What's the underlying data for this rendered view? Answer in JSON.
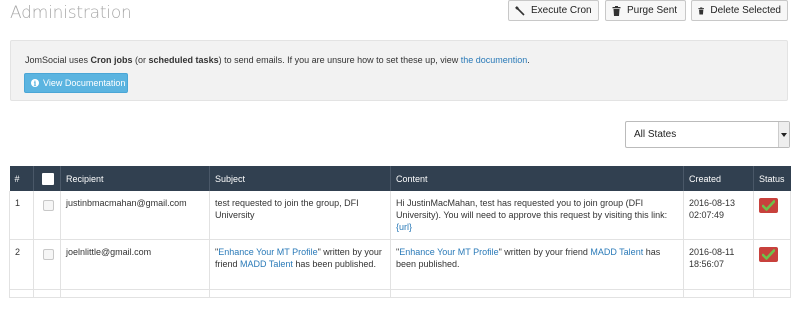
{
  "header": {
    "title": "Administration"
  },
  "toolbar": {
    "execute_cron": "Execute Cron",
    "purge_sent": "Purge Sent",
    "delete_selected": "Delete Selected"
  },
  "notice": {
    "text_1": "JomSocial uses ",
    "bold_1": "Cron jobs",
    "text_2": " (or ",
    "bold_2": "scheduled tasks",
    "text_3": ") to send emails. If you are unsure how to set these up, view ",
    "link": "the documention",
    "text_4": ".",
    "button": "View Documentation"
  },
  "filter": {
    "selected": "All States"
  },
  "table": {
    "columns": [
      "#",
      "",
      "Recipient",
      "Subject",
      "Content",
      "Created",
      "Status"
    ],
    "rows": [
      {
        "num": "1",
        "recipient": "justinbmacmahan@gmail.com",
        "subject": "test requested to join the group, DFI University",
        "content_text": "Hi JustinMacMahan, test has requested you to join group (DFI University). You will need to approve this request by visiting this link: ",
        "content_link": "{url}",
        "created_date": "2016-08-13",
        "created_time": "02:07:49",
        "status": "sent"
      },
      {
        "num": "2",
        "recipient": "joelnlittle@gmail.com",
        "subject_q1": "\"",
        "subject_link1": "Enhance Your MT Profile",
        "subject_mid": "\" written by your friend ",
        "subject_link2": "MADD Talent",
        "subject_end": " has been published.",
        "content_q1": "\"",
        "content_link1": "Enhance Your MT Profile",
        "content_mid": "\" written by your friend ",
        "content_link2": "MADD Talent",
        "content_end": " has been published.",
        "created_date": "2016-08-11",
        "created_time": "18:56:07",
        "status": "sent"
      }
    ]
  },
  "colors": {
    "header_bg": "#314050",
    "status_bg": "#c8413c",
    "check": "#6cc24a",
    "link": "#2a7ab8",
    "doc_button": "#5bb4e0"
  }
}
